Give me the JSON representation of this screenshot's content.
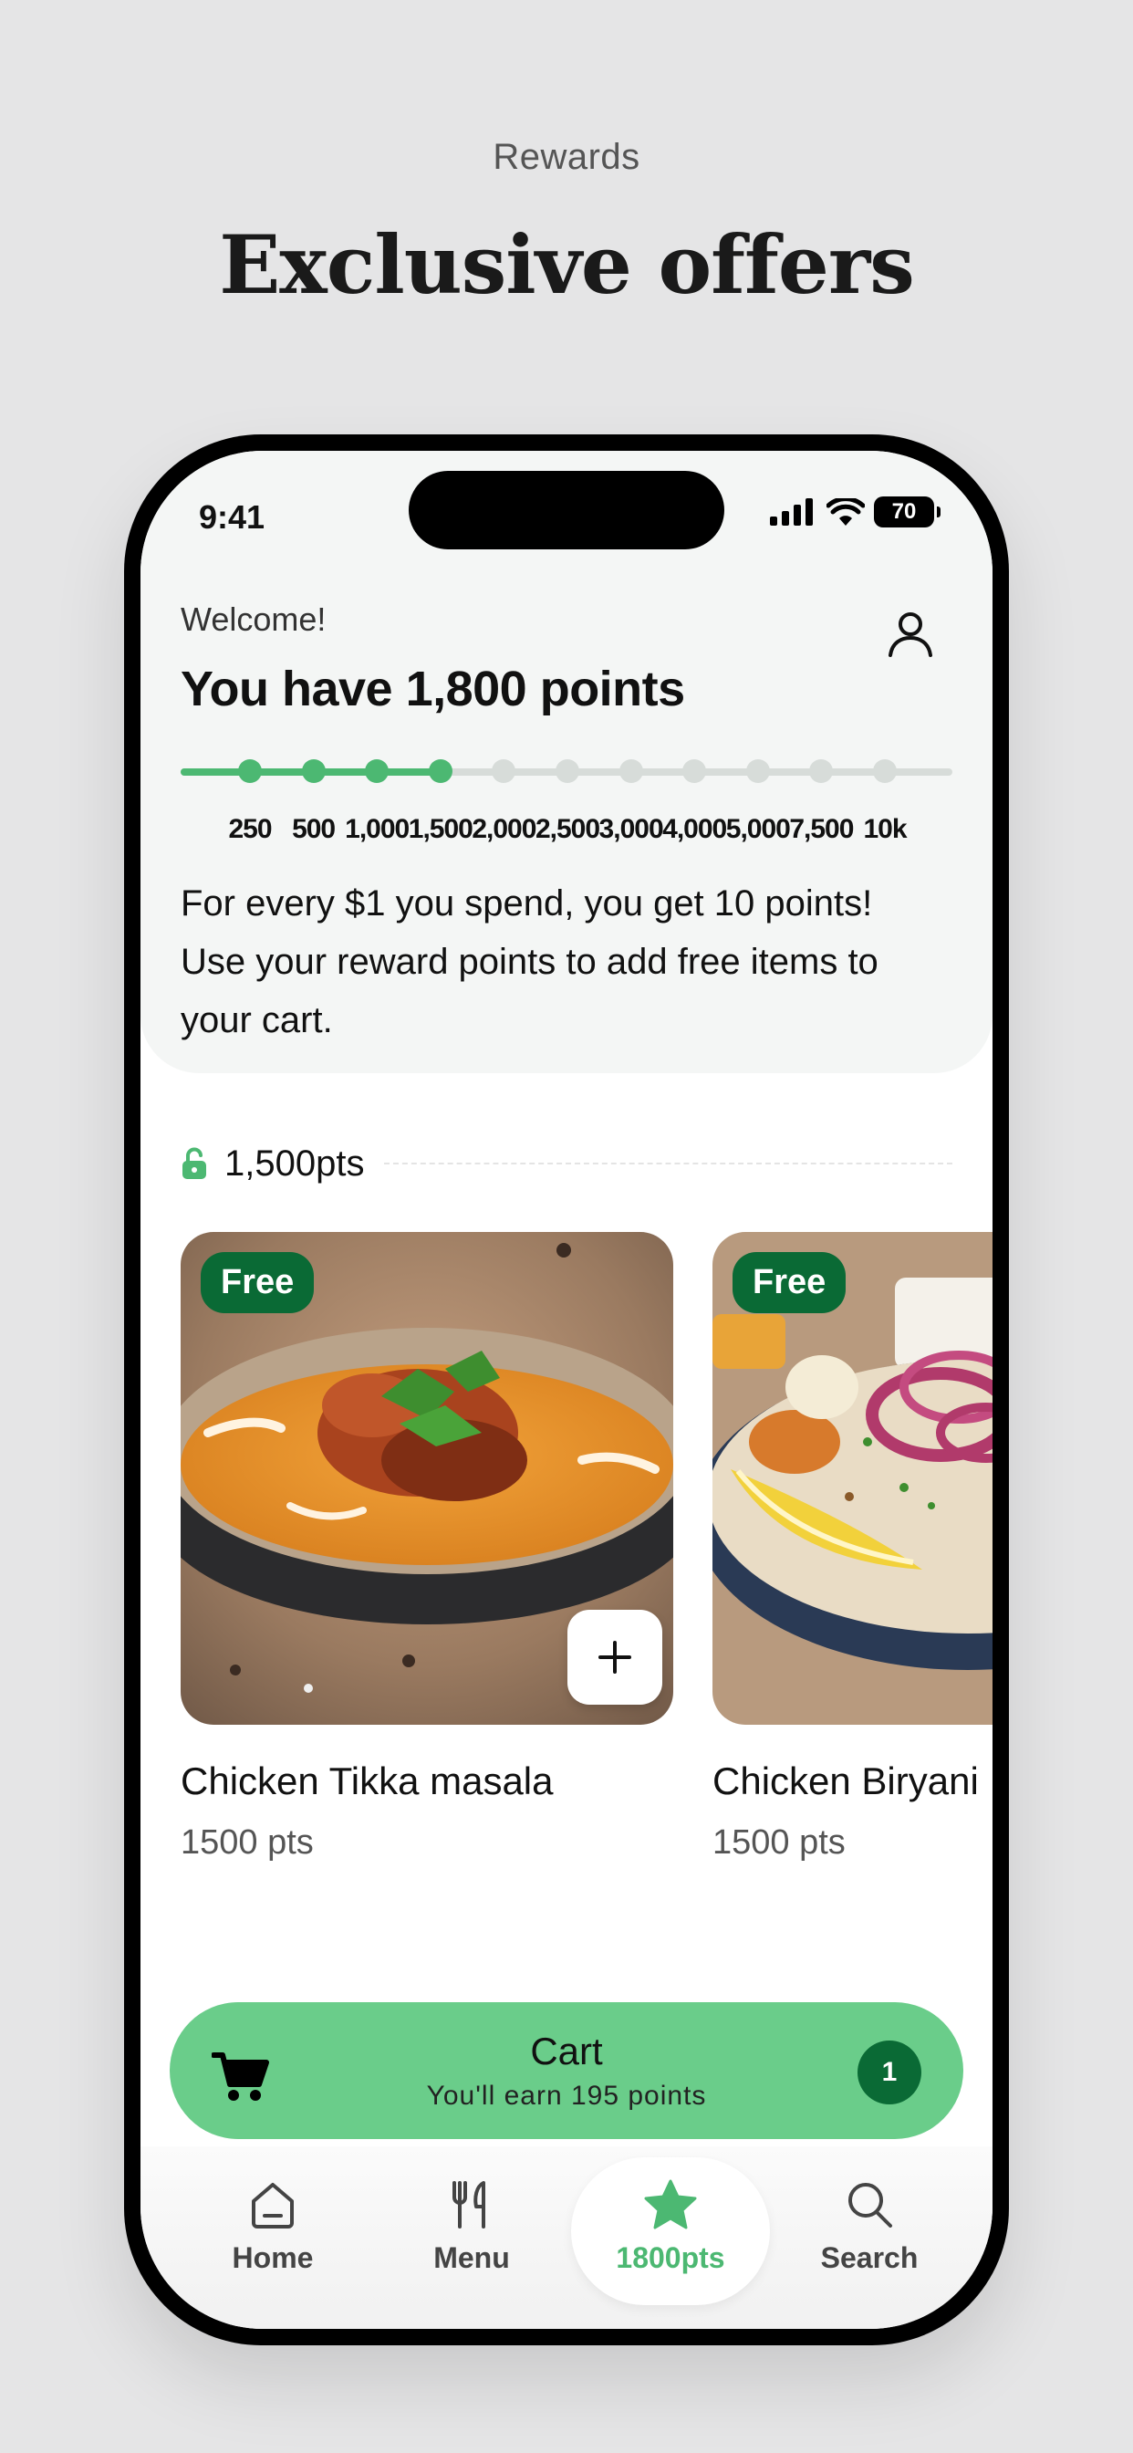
{
  "page": {
    "eyebrow": "Rewards",
    "headline": "Exclusive offers"
  },
  "status_bar": {
    "time": "9:41",
    "battery": "70"
  },
  "header": {
    "welcome": "Welcome!",
    "points_title": "You have 1,800 points",
    "description": "For every $1 you spend, you get 10 points! Use your reward points to add free items to your cart.",
    "profile_icon": "user-icon"
  },
  "progress": {
    "current_points": 1800,
    "tiers": [
      "250",
      "500",
      "1,000",
      "1,500",
      "2,000",
      "2,500",
      "3,000",
      "4,000",
      "5,000",
      "7,500",
      "10k"
    ],
    "unlocked_count": 4,
    "accent": "#4cb872",
    "track_color": "#d7dcd9"
  },
  "offers": {
    "tier_label": "1,500pts",
    "tier_icon": "unlock-icon",
    "items": [
      {
        "badge": "Free",
        "name": "Chicken Tikka masala",
        "pts": "1500 pts"
      },
      {
        "badge": "Free",
        "name": "Chicken Biryani",
        "pts": "1500 pts"
      }
    ]
  },
  "cart": {
    "title": "Cart",
    "subtitle": "You'll earn 195 points",
    "count": "1",
    "color": "#6acd8a"
  },
  "tabbar": {
    "tabs": [
      {
        "label": "Home",
        "icon": "home-icon"
      },
      {
        "label": "Menu",
        "icon": "utensils-icon"
      },
      {
        "label": "1800pts",
        "icon": "star-icon",
        "active": true
      },
      {
        "label": "Search",
        "icon": "search-icon"
      }
    ]
  }
}
